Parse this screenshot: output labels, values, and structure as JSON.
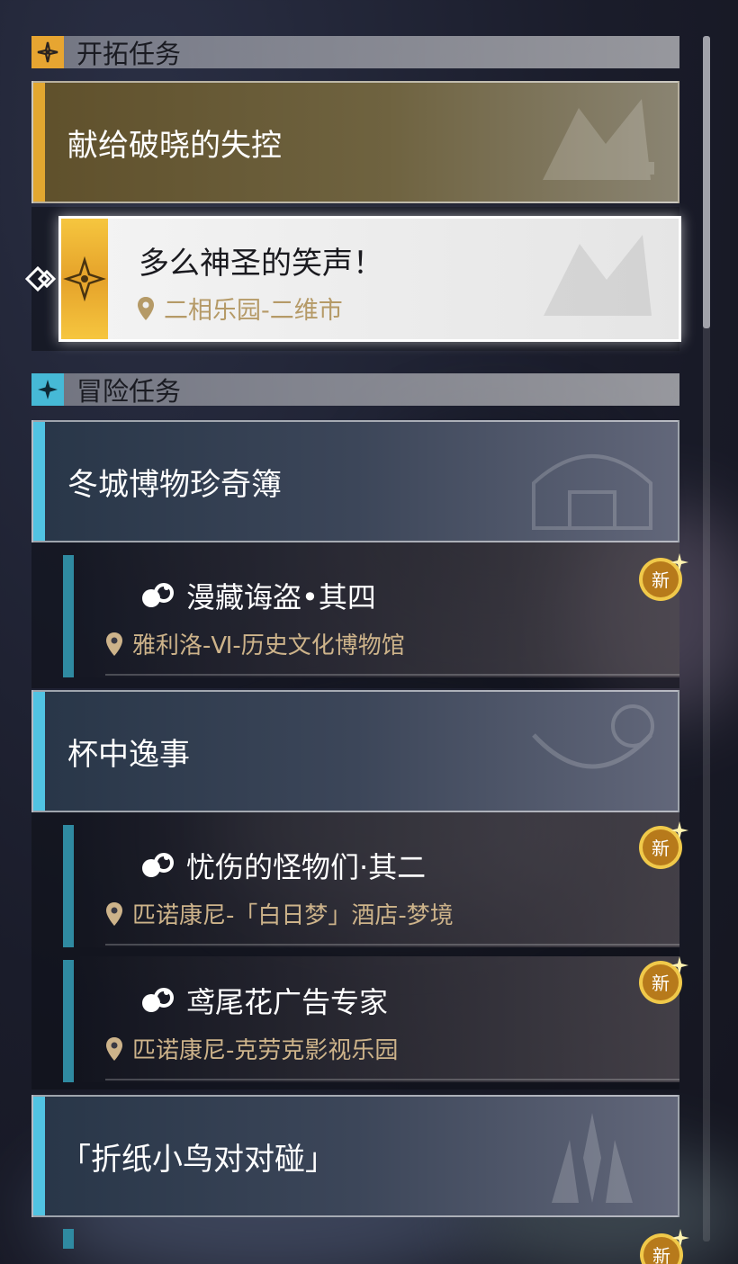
{
  "sections": {
    "trailblaze": {
      "label": "开拓任务",
      "accent": "#e7a531",
      "parent_quest": "献给破晓的失控",
      "selected_quest": {
        "title": "多么神圣的笑声！",
        "location": "二相乐园-二维市"
      }
    },
    "adventure": {
      "label": "冒险任务",
      "accent": "#46b9d6",
      "groups": [
        {
          "title": "冬城博物珍奇簿",
          "quests": [
            {
              "title": "漫藏诲盗•其四",
              "location": "雅利洛-Ⅵ-历史文化博物馆",
              "badge": "新"
            }
          ]
        },
        {
          "title": "杯中逸事",
          "quests": [
            {
              "title": "忧伤的怪物们·其二",
              "location": "匹诺康尼-「白日梦」酒店-梦境",
              "badge": "新"
            },
            {
              "title": "鸢尾花广告专家",
              "location": "匹诺康尼-克劳克影视乐园",
              "badge": "新"
            }
          ]
        },
        {
          "title": "「折纸小鸟对对碰」",
          "quests": []
        }
      ],
      "peek_badge": "新"
    }
  },
  "colors": {
    "gold_stripe": "#e2a730",
    "cyan_stripe": "#51c3e2",
    "sub_bar": "#2f8aa1",
    "location_text": "#cdb38a",
    "badge_fill": "#b77a1b"
  },
  "icons": [
    "trailblaze-icon",
    "adventure-icon",
    "location-pin-icon",
    "quest-type-icon",
    "new-badge-icon",
    "selection-arrow-icon",
    "scrollbar"
  ]
}
